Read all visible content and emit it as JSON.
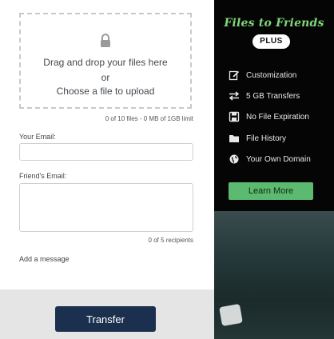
{
  "upload": {
    "drag_text": "Drag and drop your files here",
    "or_text": "or",
    "choose_text": "Choose a file to upload",
    "limit_text": "0 of 10 files - 0 MB of 1GB limit"
  },
  "form": {
    "your_email_label": "Your Email:",
    "your_email_value": "",
    "friends_email_label": "Friend's Email:",
    "friends_email_value": "",
    "recipients_text": "0 of 5 recipients",
    "add_message_label": "Add a message",
    "transfer_label": "Transfer"
  },
  "promo": {
    "title": "Files to Friends",
    "badge": "PLUS",
    "features": [
      {
        "icon": "edit-icon",
        "label": "Customization"
      },
      {
        "icon": "transfer-arrows-icon",
        "label": "5 GB Transfers"
      },
      {
        "icon": "floppy-disk-icon",
        "label": "No File Expiration"
      },
      {
        "icon": "folder-icon",
        "label": "File History"
      },
      {
        "icon": "globe-icon",
        "label": "Your Own Domain"
      }
    ],
    "cta_label": "Learn More"
  },
  "colors": {
    "primary_button": "#1b2f4e",
    "accent_green": "#5cb970",
    "brand_green": "#7fd67a"
  }
}
